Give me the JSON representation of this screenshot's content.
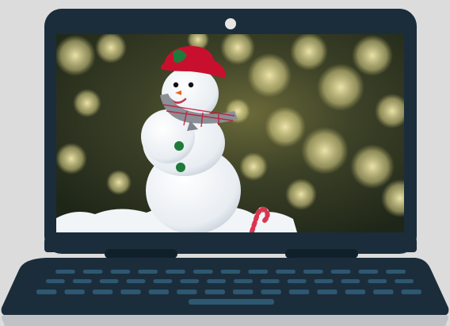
{
  "illustration": {
    "background_color": "#dcdcdc",
    "laptop_color": "#1b2d3b",
    "key_color": "#2e5872",
    "base_edge_color": "#bfc3c7",
    "camera_color": "#e6e6e6",
    "screen_scene": "snowman-photo",
    "hat_color": "#c8102e",
    "scarf_color": "#8b8f96",
    "button_color": "#1f7a3a",
    "candy_cane_color": "#d9364f"
  }
}
